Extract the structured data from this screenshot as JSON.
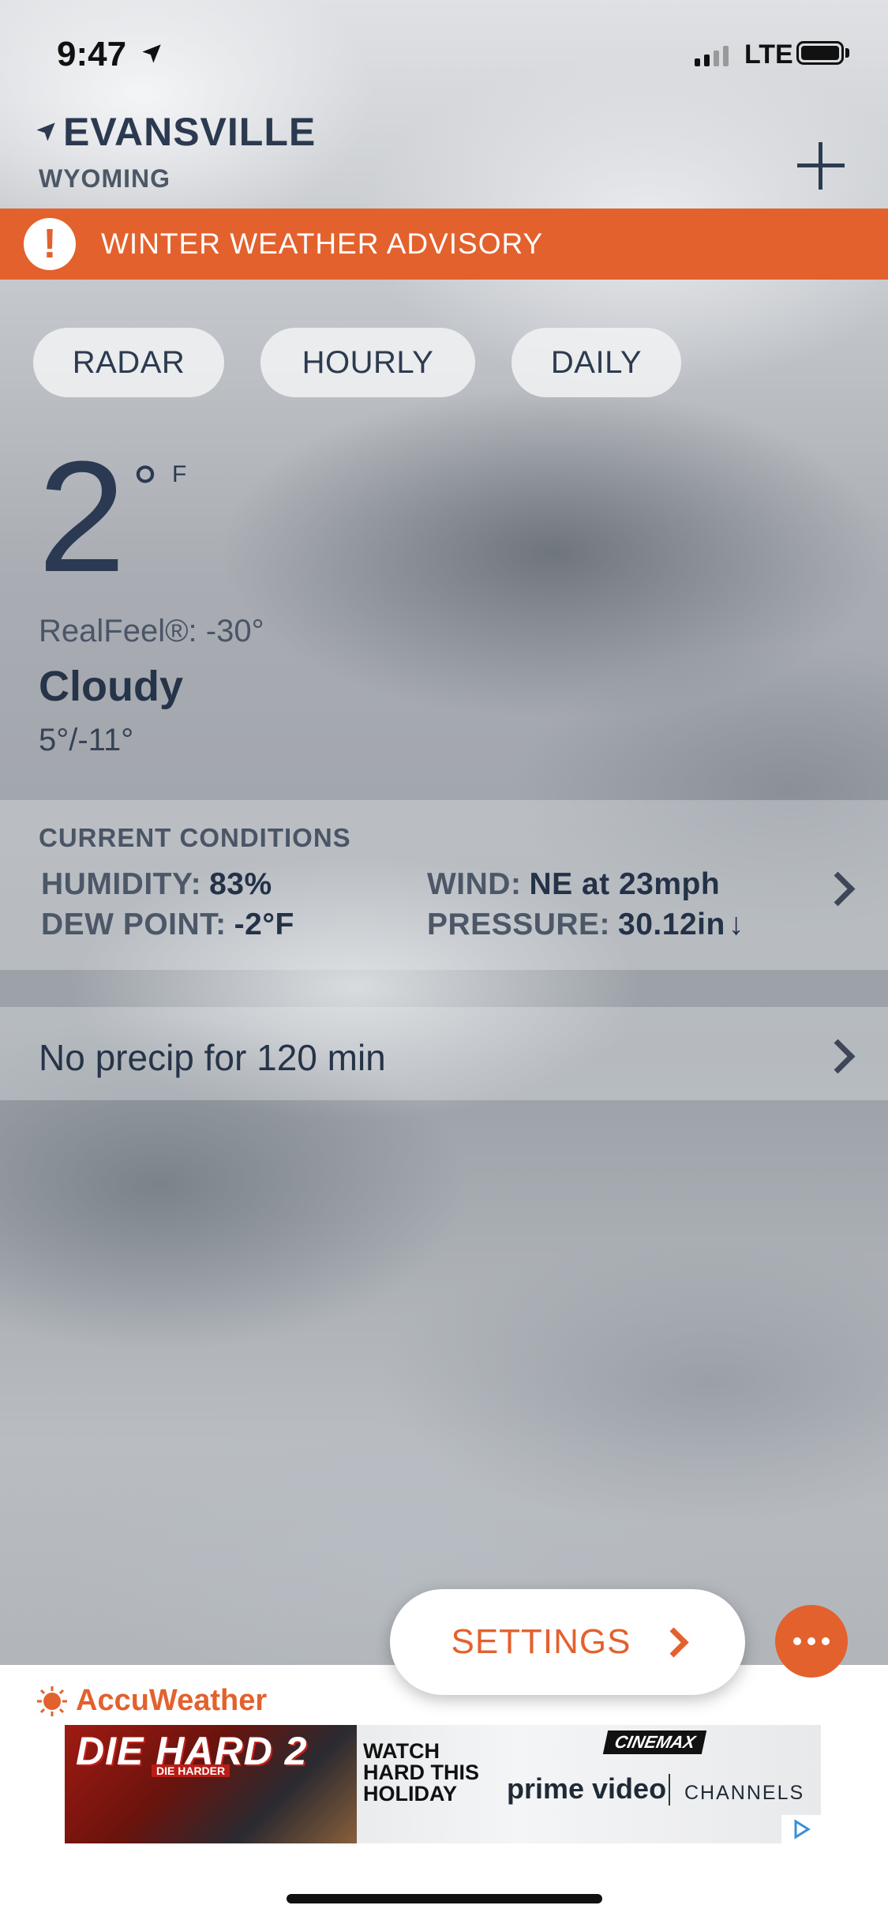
{
  "status_bar": {
    "time": "9:47",
    "network": "LTE"
  },
  "location": {
    "city": "EVANSVILLE",
    "state": "WYOMING"
  },
  "advisory": {
    "icon": "!",
    "text": "WINTER WEATHER ADVISORY",
    "color": "#e3612d"
  },
  "tabs": [
    {
      "label": "RADAR"
    },
    {
      "label": "HOURLY"
    },
    {
      "label": "DAILY"
    }
  ],
  "current": {
    "temp": "2",
    "degree": "°",
    "unit": "F",
    "realfeel": "RealFeel®: -30°",
    "condition": "Cloudy",
    "hilo": "5°/-11°"
  },
  "conditions": {
    "title": "CURRENT CONDITIONS",
    "humidity_label": "HUMIDITY:",
    "humidity_value": "83%",
    "dew_label": "DEW POINT:",
    "dew_value": "-2°F",
    "wind_label": "WIND:",
    "wind_value": "NE at 23mph",
    "pressure_label": "PRESSURE:",
    "pressure_value": "30.12in",
    "pressure_trend": "↓"
  },
  "precip": {
    "text": "No precip for 120 min"
  },
  "settings": {
    "label": "SETTINGS"
  },
  "brand": {
    "name": "AccuWeather",
    "color": "#e3612d"
  },
  "ad": {
    "title": "DIE HARD 2",
    "subtitle": "DIE HARDER",
    "tagline": "WATCH HARD THIS HOLIDAY",
    "network": "CINEMAX",
    "service": "prime video",
    "service_suffix": "CHANNELS"
  }
}
